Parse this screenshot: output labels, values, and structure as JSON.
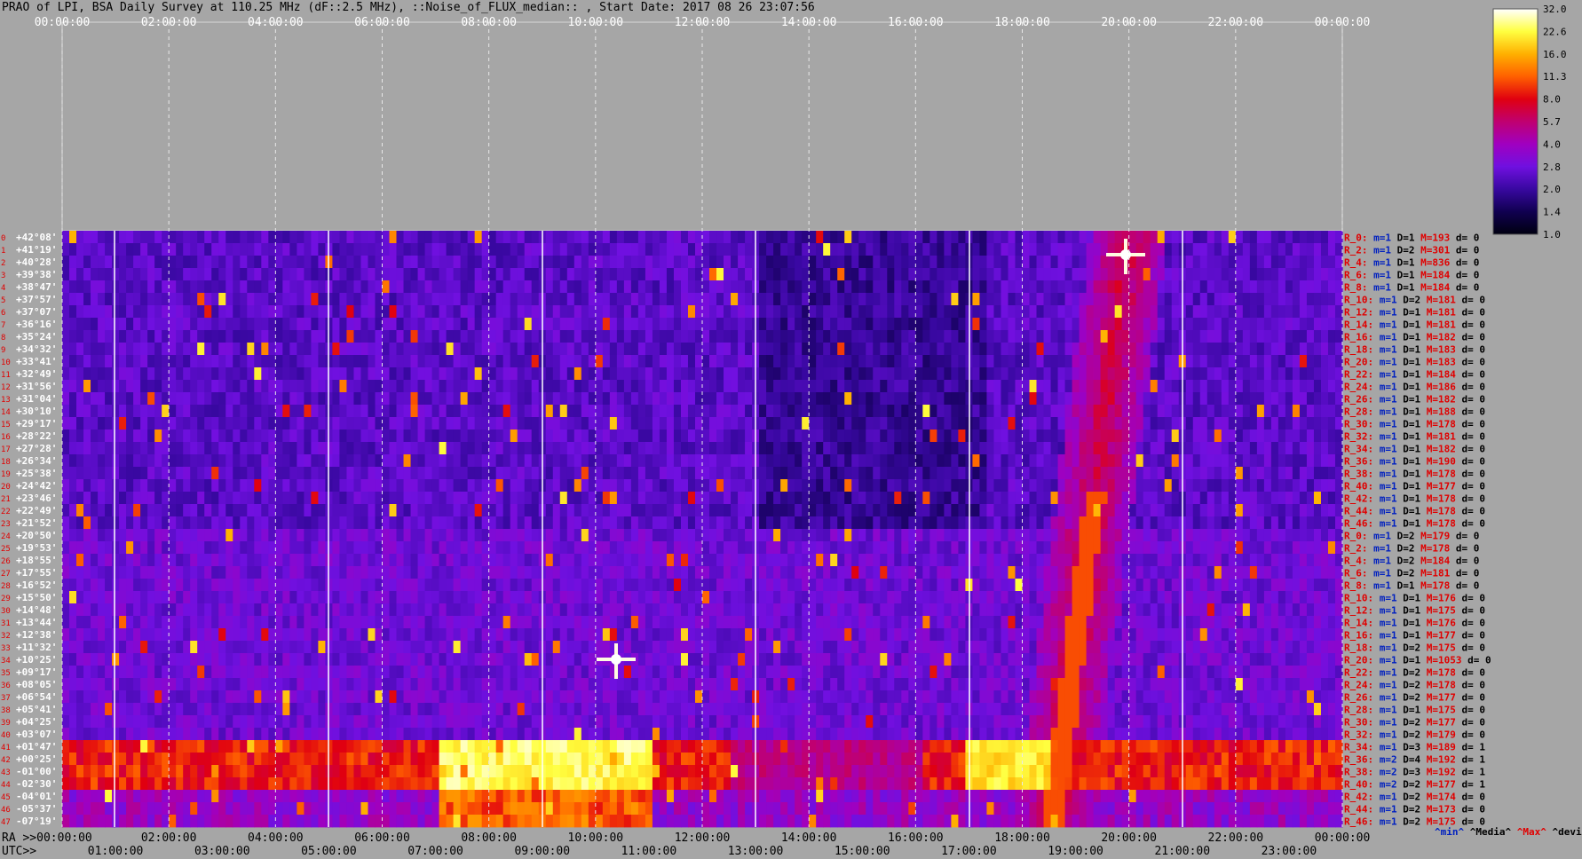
{
  "title": "PRAO of LPI, BSA Daily Survey at 110.25 MHz (dF::2.5 MHz), ::Noise_of_FLUX_median:: , Start Date: 2017 08 26 23:07:56",
  "colorbar": {
    "ticks": [
      "32.0",
      "22.6",
      "16.0",
      "11.3",
      "8.0",
      "5.7",
      "4.0",
      "2.8",
      "2.0",
      "1.4",
      "1.0"
    ],
    "colors": [
      "#ffffff",
      "#ffff40",
      "#ffb000",
      "#ff6000",
      "#e00010",
      "#c00070",
      "#a000c0",
      "#7010e0",
      "#3808a0",
      "#100050",
      "#000010"
    ]
  },
  "chart_data": {
    "type": "heatmap",
    "top_time_ticks": [
      "00:00:00",
      "02:00:00",
      "04:00:00",
      "06:00:00",
      "08:00:00",
      "10:00:00",
      "12:00:00",
      "14:00:00",
      "16:00:00",
      "18:00:00",
      "20:00:00",
      "22:00:00",
      "00:00:00"
    ],
    "bottom_ra_ticks": [
      "RA >>00:00:00",
      "02:00:00",
      "04:00:00",
      "06:00:00",
      "08:00:00",
      "10:00:00",
      "12:00:00",
      "14:00:00",
      "16:00:00",
      "18:00:00",
      "20:00:00",
      "22:00:00",
      "00:00:00"
    ],
    "bottom_utc_ticks": [
      "UTC>>",
      "01:00:00",
      "03:00:00",
      "05:00:00",
      "07:00:00",
      "09:00:00",
      "11:00:00",
      "13:00:00",
      "15:00:00",
      "17:00:00",
      "19:00:00",
      "21:00:00",
      "23:00:00"
    ],
    "declinations": [
      "+42°08'",
      "+41°19'",
      "+40°28'",
      "+39°38'",
      "+38°47'",
      "+37°57'",
      "+37°07'",
      "+36°16'",
      "+35°24'",
      "+34°32'",
      "+33°41'",
      "+32°49'",
      "+31°56'",
      "+31°04'",
      "+30°10'",
      "+29°17'",
      "+28°22'",
      "+27°28'",
      "+26°34'",
      "+25°38'",
      "+24°42'",
      "+23°46'",
      "+22°49'",
      "+21°52'",
      "+20°50'",
      "+19°53'",
      "+18°55'",
      "+17°55'",
      "+16°52'",
      "+15°50'",
      "+14°48'",
      "+13°44'",
      "+12°38'",
      "+11°32'",
      "+10°25'",
      "+09°17'",
      "+08°05'",
      "+06°54'",
      "+05°41'",
      "+04°25'",
      "+03°07'",
      "+01°47'",
      "+00°25'",
      "-01°00'",
      "-02°30'",
      "-04°01'",
      "-05°37'",
      "-07°19'"
    ],
    "row_stats": [
      {
        "r": "R_0:",
        "m": "m=1",
        "d": "D=1",
        "M": "M=193",
        "dv": "d= 0"
      },
      {
        "r": "R_2:",
        "m": "m=1",
        "d": "D=2",
        "M": "M=301",
        "dv": "d= 0"
      },
      {
        "r": "R_4:",
        "m": "m=1",
        "d": "D=1",
        "M": "M=836",
        "dv": "d= 0"
      },
      {
        "r": "R_6:",
        "m": "m=1",
        "d": "D=1",
        "M": "M=184",
        "dv": "d= 0"
      },
      {
        "r": "R_8:",
        "m": "m=1",
        "d": "D=1",
        "M": "M=184",
        "dv": "d= 0"
      },
      {
        "r": "R_10:",
        "m": "m=1",
        "d": "D=2",
        "M": "M=181",
        "dv": "d= 0"
      },
      {
        "r": "R_12:",
        "m": "m=1",
        "d": "D=1",
        "M": "M=181",
        "dv": "d= 0"
      },
      {
        "r": "R_14:",
        "m": "m=1",
        "d": "D=1",
        "M": "M=181",
        "dv": "d= 0"
      },
      {
        "r": "R_16:",
        "m": "m=1",
        "d": "D=1",
        "M": "M=182",
        "dv": "d= 0"
      },
      {
        "r": "R_18:",
        "m": "m=1",
        "d": "D=1",
        "M": "M=183",
        "dv": "d= 0"
      },
      {
        "r": "R_20:",
        "m": "m=1",
        "d": "D=1",
        "M": "M=183",
        "dv": "d= 0"
      },
      {
        "r": "R_22:",
        "m": "m=1",
        "d": "D=1",
        "M": "M=184",
        "dv": "d= 0"
      },
      {
        "r": "R_24:",
        "m": "m=1",
        "d": "D=1",
        "M": "M=186",
        "dv": "d= 0"
      },
      {
        "r": "R_26:",
        "m": "m=1",
        "d": "D=1",
        "M": "M=182",
        "dv": "d= 0"
      },
      {
        "r": "R_28:",
        "m": "m=1",
        "d": "D=1",
        "M": "M=188",
        "dv": "d= 0"
      },
      {
        "r": "R_30:",
        "m": "m=1",
        "d": "D=1",
        "M": "M=178",
        "dv": "d= 0"
      },
      {
        "r": "R_32:",
        "m": "m=1",
        "d": "D=1",
        "M": "M=181",
        "dv": "d= 0"
      },
      {
        "r": "R_34:",
        "m": "m=1",
        "d": "D=1",
        "M": "M=182",
        "dv": "d= 0"
      },
      {
        "r": "R_36:",
        "m": "m=1",
        "d": "D=1",
        "M": "M=190",
        "dv": "d= 0"
      },
      {
        "r": "R_38:",
        "m": "m=1",
        "d": "D=1",
        "M": "M=178",
        "dv": "d= 0"
      },
      {
        "r": "R_40:",
        "m": "m=1",
        "d": "D=1",
        "M": "M=177",
        "dv": "d= 0"
      },
      {
        "r": "R_42:",
        "m": "m=1",
        "d": "D=1",
        "M": "M=178",
        "dv": "d= 0"
      },
      {
        "r": "R_44:",
        "m": "m=1",
        "d": "D=1",
        "M": "M=178",
        "dv": "d= 0"
      },
      {
        "r": "R_46:",
        "m": "m=1",
        "d": "D=1",
        "M": "M=178",
        "dv": "d= 0"
      },
      {
        "r": "R_0:",
        "m": "m=1",
        "d": "D=2",
        "M": "M=179",
        "dv": "d= 0"
      },
      {
        "r": "R_2:",
        "m": "m=1",
        "d": "D=2",
        "M": "M=178",
        "dv": "d= 0"
      },
      {
        "r": "R_4:",
        "m": "m=1",
        "d": "D=2",
        "M": "M=184",
        "dv": "d= 0"
      },
      {
        "r": "R_6:",
        "m": "m=1",
        "d": "D=2",
        "M": "M=181",
        "dv": "d= 0"
      },
      {
        "r": "R_8:",
        "m": "m=1",
        "d": "D=1",
        "M": "M=178",
        "dv": "d= 0"
      },
      {
        "r": "R_10:",
        "m": "m=1",
        "d": "D=1",
        "M": "M=176",
        "dv": "d= 0"
      },
      {
        "r": "R_12:",
        "m": "m=1",
        "d": "D=1",
        "M": "M=175",
        "dv": "d= 0"
      },
      {
        "r": "R_14:",
        "m": "m=1",
        "d": "D=1",
        "M": "M=176",
        "dv": "d= 0"
      },
      {
        "r": "R_16:",
        "m": "m=1",
        "d": "D=1",
        "M": "M=177",
        "dv": "d= 0"
      },
      {
        "r": "R_18:",
        "m": "m=1",
        "d": "D=2",
        "M": "M=175",
        "dv": "d= 0"
      },
      {
        "r": "R_20:",
        "m": "m=1",
        "d": "D=1",
        "M": "M=1053",
        "dv": "d= 0"
      },
      {
        "r": "R_22:",
        "m": "m=1",
        "d": "D=2",
        "M": "M=178",
        "dv": "d= 0"
      },
      {
        "r": "R_24:",
        "m": "m=1",
        "d": "D=2",
        "M": "M=178",
        "dv": "d= 0"
      },
      {
        "r": "R_26:",
        "m": "m=1",
        "d": "D=2",
        "M": "M=177",
        "dv": "d= 0"
      },
      {
        "r": "R_28:",
        "m": "m=1",
        "d": "D=1",
        "M": "M=175",
        "dv": "d= 0"
      },
      {
        "r": "R_30:",
        "m": "m=1",
        "d": "D=2",
        "M": "M=177",
        "dv": "d= 0"
      },
      {
        "r": "R_32:",
        "m": "m=1",
        "d": "D=2",
        "M": "M=179",
        "dv": "d= 0"
      },
      {
        "r": "R_34:",
        "m": "m=1",
        "d": "D=3",
        "M": "M=189",
        "dv": "d= 1"
      },
      {
        "r": "R_36:",
        "m": "m=2",
        "d": "D=4",
        "M": "M=192",
        "dv": "d= 1"
      },
      {
        "r": "R_38:",
        "m": "m=2",
        "d": "D=3",
        "M": "M=192",
        "dv": "d= 1"
      },
      {
        "r": "R_40:",
        "m": "m=2",
        "d": "D=2",
        "M": "M=177",
        "dv": "d= 1"
      },
      {
        "r": "R_42:",
        "m": "m=1",
        "d": "D=2",
        "M": "M=174",
        "dv": "d= 0"
      },
      {
        "r": "R_44:",
        "m": "m=1",
        "d": "D=2",
        "M": "M=173",
        "dv": "d= 0"
      },
      {
        "r": "R_46:",
        "m": "m=1",
        "d": "D=2",
        "M": "M=175",
        "dv": "d= 0"
      }
    ],
    "stats_legend": {
      "min": "^min^",
      "media": "^Media^",
      "max": "^Max^",
      "devia": "^devia^"
    },
    "rows": 48,
    "colorbar_range": [
      1.0,
      32.0
    ]
  }
}
